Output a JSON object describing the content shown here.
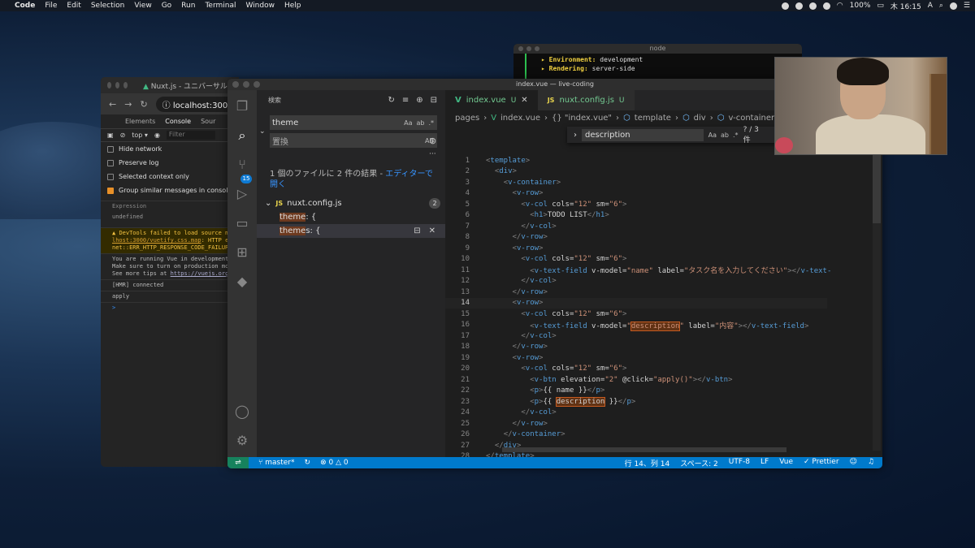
{
  "menubar": {
    "app": "Code",
    "items": [
      "File",
      "Edit",
      "Selection",
      "View",
      "Go",
      "Run",
      "Terminal",
      "Window",
      "Help"
    ],
    "battery": "100%",
    "clock": "木 16:15",
    "input_mode": "A"
  },
  "chrome": {
    "tab_title": "Nuxt.js - ユニバーサル Vu",
    "url": "localhost:3000",
    "devtools_tabs": [
      "Elements",
      "Console",
      "Sour"
    ],
    "context": "top",
    "filter_placeholder": "Filter",
    "options": [
      {
        "label": "Hide network",
        "checked": false
      },
      {
        "label": "Preserve log",
        "checked": false
      },
      {
        "label": "Selected context only",
        "checked": false
      },
      {
        "label": "Group similar messages in console",
        "checked": true
      }
    ],
    "expression_label": "Expression",
    "expression_value": "undefined",
    "warn_line1": "DevTools failed to load source map",
    "warn_link": "lhost:3000/vuetify.css.map",
    "warn_line2_rest": ": HTTP e",
    "warn_line3": "net::ERR_HTTP_RESPONSE_CODE_FAILUR",
    "info1": "You are running Vue in development",
    "info2": "Make sure to turn on production mo",
    "info3_pre": "See more tips at ",
    "info3_link": "https://vuejs.org",
    "hmr": "[HMR] connected",
    "apply": "apply",
    "prompt": ">"
  },
  "node": {
    "title": "node",
    "line1_label": "Environment:",
    "line1_value": "development",
    "line2_label": "Rendering:",
    "line2_value": "server-side"
  },
  "vscode": {
    "title": "index.vue — live-coding",
    "scm_badge": "15",
    "search": {
      "header": "検索",
      "query": "theme",
      "replace_placeholder": "置換",
      "case_toggle": "Aa",
      "word_toggle": "ab",
      "regex_toggle": ".*",
      "preserve_case": "AB",
      "summary": "1 個のファイルに 2 件の結果 - ",
      "open_editor": "エディターで開く",
      "file": "nuxt.config.js",
      "file_count": "2",
      "matches": [
        {
          "hl": "theme",
          "rest": ": {"
        },
        {
          "hl": "theme",
          "rest": "s: {"
        }
      ]
    },
    "tabs": [
      {
        "label": "index.vue",
        "status": "U"
      },
      {
        "label": "nuxt.config.js",
        "status": "U"
      }
    ],
    "breadcrumb": [
      "pages",
      "index.vue",
      "{} \"index.vue\"",
      "template",
      "div",
      "v-container",
      "v-"
    ],
    "find": {
      "query": "description",
      "result": "? / 3 件"
    },
    "code_lines": [
      [
        "1",
        "<template>"
      ],
      [
        "2",
        "  <div>"
      ],
      [
        "3",
        "    <v-container>"
      ],
      [
        "4",
        "      <v-row>"
      ],
      [
        "5",
        "        <v-col cols=\"12\" sm=\"6\">"
      ],
      [
        "6",
        "          <h1>TODO LIST</h1>"
      ],
      [
        "7",
        "        </v-col>"
      ],
      [
        "8",
        "      </v-row>"
      ],
      [
        "9",
        "      <v-row>"
      ],
      [
        "10",
        "        <v-col cols=\"12\" sm=\"6\">"
      ],
      [
        "11",
        "          <v-text-field v-model=\"name\" label=\"タスク名を入力してください\"></v-text-"
      ],
      [
        "12",
        "        </v-col>"
      ],
      [
        "13",
        "      </v-row>"
      ],
      [
        "14",
        "      <v-row>"
      ],
      [
        "15",
        "        <v-col cols=\"12\" sm=\"6\">"
      ],
      [
        "16",
        "          <v-text-field v-model=\"description\" label=\"内容\"></v-text-field>"
      ],
      [
        "17",
        "        </v-col>"
      ],
      [
        "18",
        "      </v-row>"
      ],
      [
        "19",
        "      <v-row>"
      ],
      [
        "20",
        "        <v-col cols=\"12\" sm=\"6\">"
      ],
      [
        "21",
        "          <v-btn elevation=\"2\" @click=\"apply()\"></v-btn>"
      ],
      [
        "22",
        "          <p>{{ name }}</p>"
      ],
      [
        "23",
        "          <p>{{ description }}</p>"
      ],
      [
        "24",
        "        </v-col>"
      ],
      [
        "25",
        "      </v-row>"
      ],
      [
        "26",
        "    </v-container>"
      ],
      [
        "27",
        "  </div>"
      ],
      [
        "28",
        "</template>"
      ]
    ],
    "status": {
      "branch": "master*",
      "errors": "0",
      "warnings": "0",
      "position": "行 14、列 14",
      "spaces": "スペース: 2",
      "encoding": "UTF-8",
      "eol": "LF",
      "language": "Vue",
      "formatter": "Prettier"
    }
  }
}
